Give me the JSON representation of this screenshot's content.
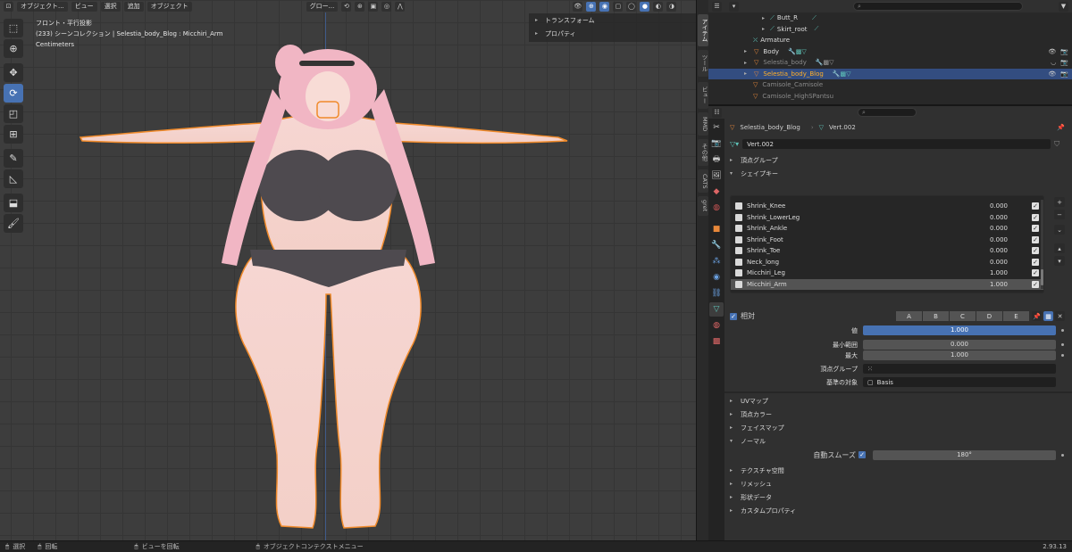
{
  "viewport": {
    "header": {
      "mode": "オブジェクト...",
      "menus": [
        "ビュー",
        "選択",
        "追加",
        "オブジェクト"
      ],
      "transform_orientation": "グロー..."
    },
    "info": {
      "view_name": "フロント・平行投影",
      "collection": "(233) シーンコレクション | Selestia_body_Blog : Micchiri_Arm",
      "units": "Centimeters"
    },
    "npanel": {
      "transform": "トランスフォーム",
      "properties": "プロパティ"
    },
    "side_tabs": [
      "アイテム",
      "ツール",
      "ビュー",
      "MMD",
      "その他",
      "CATS",
      "gret"
    ]
  },
  "outliner": {
    "rows": [
      {
        "name": "Butt_R"
      },
      {
        "name": "Skirt_root"
      },
      {
        "name": "Armature"
      },
      {
        "name": "Body"
      },
      {
        "name": "Selestia_body"
      },
      {
        "name": "Selestia_body_Blog"
      },
      {
        "name": "Camisole_Camisole"
      },
      {
        "name": "Camisole_HighSPantsu"
      }
    ]
  },
  "properties": {
    "breadcrumb_object": "Selestia_body_Blog",
    "breadcrumb_data": "Vert.002",
    "mesh_name": "Vert.002",
    "sections": {
      "vertex_groups": "頂点グループ",
      "shape_keys": "シェイプキー",
      "uv_maps": "UVマップ",
      "vertex_colors": "頂点カラー",
      "face_maps": "フェイスマップ",
      "normals": "ノーマル",
      "texture_space": "テクスチャ空間",
      "remesh": "リメッシュ",
      "geometry_data": "形状データ",
      "custom_properties": "カスタムプロパティ"
    },
    "shape_keys": [
      {
        "name": "Shrink_Knee",
        "value": "0.000"
      },
      {
        "name": "Shrink_LowerLeg",
        "value": "0.000"
      },
      {
        "name": "Shrink_Ankle",
        "value": "0.000"
      },
      {
        "name": "Shrink_Foot",
        "value": "0.000"
      },
      {
        "name": "Shrink_Toe",
        "value": "0.000"
      },
      {
        "name": "Neck_long",
        "value": "0.000"
      },
      {
        "name": "Micchiri_Leg",
        "value": "1.000"
      },
      {
        "name": "Micchiri_Arm",
        "value": "1.000"
      }
    ],
    "relative_label": "相対",
    "ab_buttons": [
      "A",
      "B",
      "C",
      "D",
      "E"
    ],
    "value_label": "値",
    "value": "1.000",
    "min_label": "最小範囲",
    "min": "0.000",
    "max_label": "最大",
    "max": "1.000",
    "vertex_group_label": "頂点グループ",
    "relative_to_label": "基準の対象",
    "relative_to": "Basis",
    "auto_smooth_label": "自動スムーズ",
    "auto_smooth_angle": "180°"
  },
  "statusbar": {
    "select": "選択",
    "rotate": "回転",
    "rotate_view": "ビューを回転",
    "context_menu": "オブジェクトコンテクストメニュー",
    "version": "2.93.13"
  }
}
